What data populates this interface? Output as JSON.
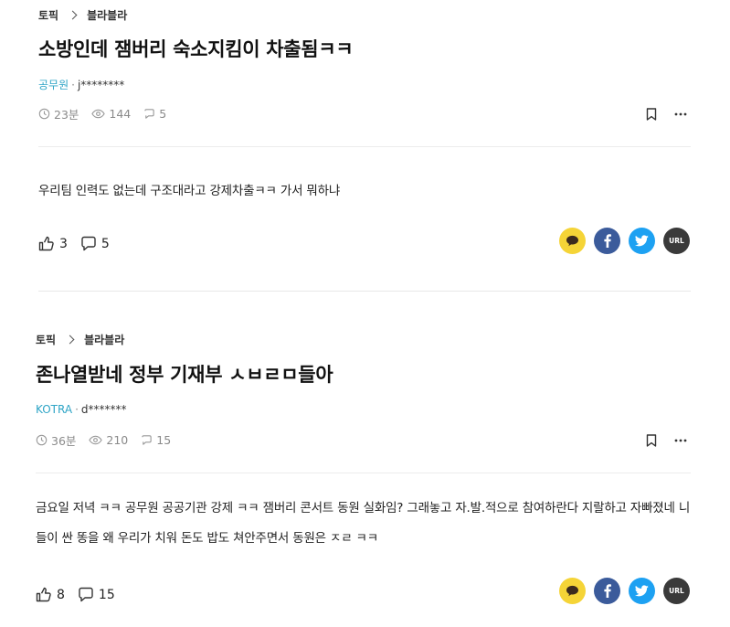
{
  "posts": [
    {
      "breadcrumb": {
        "section": "토픽",
        "category": "블라블라"
      },
      "title": "소방인데 잼버리 숙소지킴이 차출됨ㅋㅋ",
      "author": {
        "company": "공무원",
        "separator": "·",
        "user": "j********"
      },
      "meta": {
        "time": "23분",
        "views": "144",
        "comments": "5"
      },
      "body": "우리팀 인력도 없는데 구조대라고 강제차출ㅋㅋ 가서 뭐하냐",
      "reactions": {
        "likes": "3",
        "comments": "5"
      }
    },
    {
      "breadcrumb": {
        "section": "토픽",
        "category": "블라블라"
      },
      "title": "존나열받네 정부 기재부 ㅅㅂㄹㅁ들아",
      "author": {
        "company": "KOTRA",
        "separator": "·",
        "user": "d*******"
      },
      "meta": {
        "time": "36분",
        "views": "210",
        "comments": "15"
      },
      "body": "금요일 저녁 ㅋㅋ 공무원 공공기관 강제 ㅋㅋ 잼버리 콘서트 동원 실화임? 그래놓고 자.발.적으로 참여하란다 지랄하고 자빠졌네 니들이 싼 똥을 왜 우리가 치워 돈도 밥도 쳐안주면서 동원은 ㅈㄹ ㅋㅋ",
      "reactions": {
        "likes": "8",
        "comments": "15"
      }
    }
  ],
  "share": {
    "url_label": "URL"
  },
  "icons": [
    "clock-icon",
    "eye-icon",
    "comment-icon",
    "bookmark-icon",
    "more-icon",
    "thumbs-up-icon",
    "kakao-icon",
    "facebook-icon",
    "twitter-icon"
  ],
  "colors": {
    "company": "#2fa5c6",
    "kakao": "#f5d437",
    "facebook": "#3b5b9b",
    "twitter": "#1da1f2",
    "url": "#3a3a3a"
  }
}
